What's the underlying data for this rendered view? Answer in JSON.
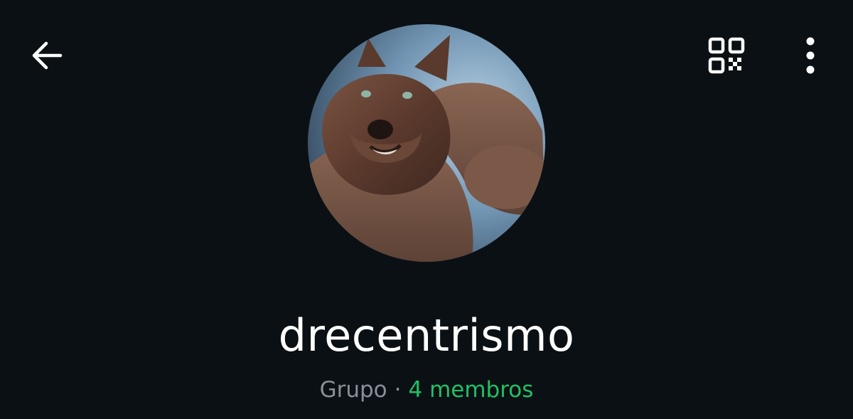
{
  "header": {
    "back_icon": "arrow-left-icon",
    "qr_icon": "qr-code-icon",
    "menu_icon": "more-vertical-icon"
  },
  "group": {
    "name": "drecentrismo",
    "kind": "Grupo",
    "separator": "·",
    "members": "4 membros",
    "avatar_description_icon": "group-avatar"
  },
  "colors": {
    "background": "#0b1014",
    "text_primary": "#ffffff",
    "text_secondary": "#8a9097",
    "accent": "#21c063"
  }
}
